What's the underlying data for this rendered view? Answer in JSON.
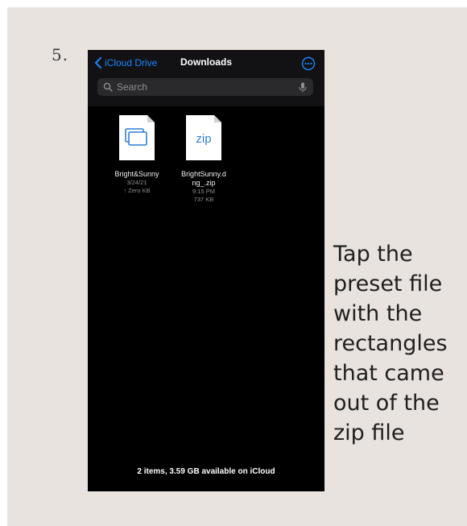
{
  "step_number": "5.",
  "instruction_lines": [
    "Tap the",
    "preset file",
    "with the",
    "rectangles",
    "that came",
    "out of the",
    "zip file"
  ],
  "screen": {
    "nav": {
      "back_label": "iCloud Drive",
      "title": "Downloads"
    },
    "search": {
      "placeholder": "Search"
    },
    "files": [
      {
        "name": "Bright&Sunny",
        "date": "3/24/21",
        "size": "↑ Zero KB",
        "icon": "preset-rectangles-icon"
      },
      {
        "name": "BrightSunny.d ng_.zip",
        "name_line1": "BrightSunny.d",
        "name_line2": "ng_.zip",
        "time": "9:15 PM",
        "size": "737 KB",
        "icon": "zip-file-icon"
      }
    ],
    "footer_status": "2 items, 3.59 GB available on iCloud"
  },
  "colors": {
    "accent": "#1d86ff",
    "background_card": "#e8e3df",
    "screen_bg": "#000000"
  }
}
